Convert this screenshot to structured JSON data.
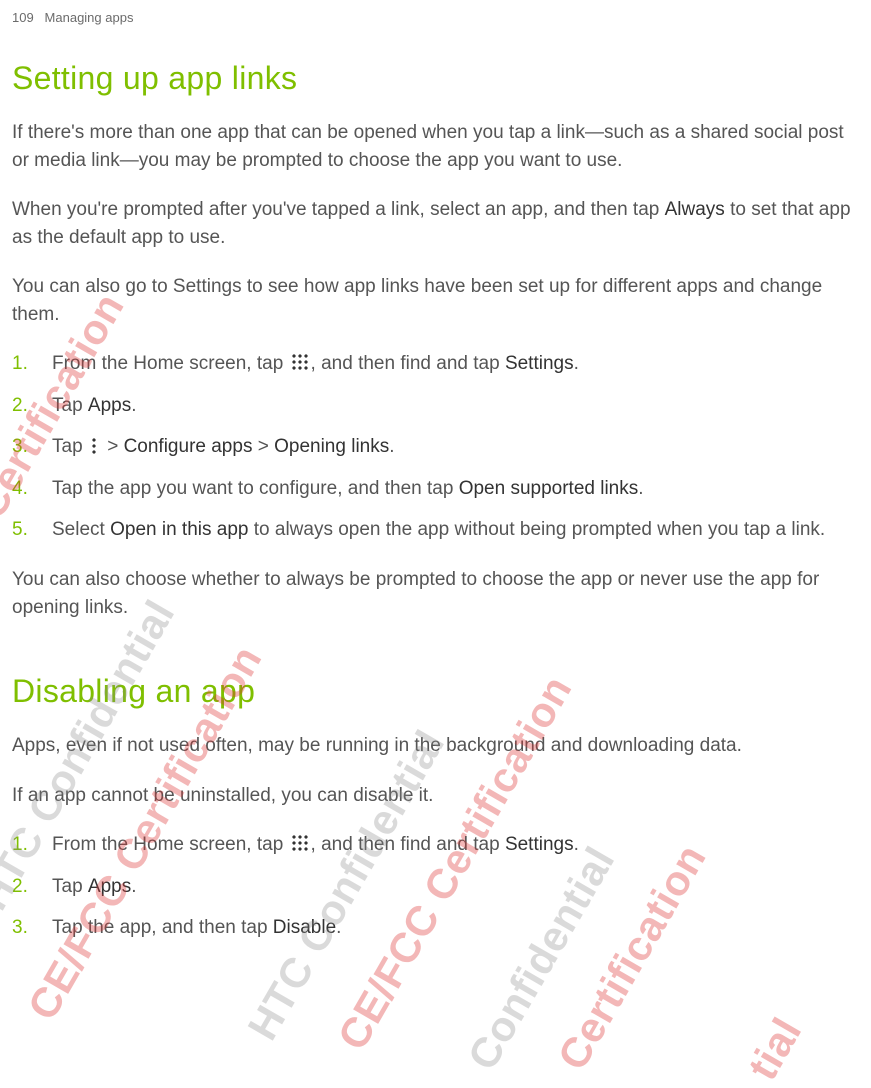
{
  "header": {
    "page_number": "109",
    "chapter": "Managing apps"
  },
  "section1": {
    "title": "Setting up app links",
    "para1": "If there's more than one app that can be opened when you tap a link—such as a shared social post or media link—you may be prompted to choose the app you want to use.",
    "para2_a": "When you're prompted after you've tapped a link, select an app, and then tap ",
    "para2_bold": "Always",
    "para2_b": " to set that app as the default app to use.",
    "para3": "You can also go to Settings to see how app links have been set up for different apps and change them.",
    "steps": [
      {
        "n": "1.",
        "before": "From the Home screen, tap ",
        "after": ", and then find and tap ",
        "bold": "Settings",
        "tail": ".",
        "icon": "apps"
      },
      {
        "n": "2.",
        "before": "Tap ",
        "bold": "Apps",
        "tail": "."
      },
      {
        "n": "3.",
        "before": "Tap ",
        "after": " > ",
        "bold": "Configure apps",
        "mid": " > ",
        "bold2": "Opening links",
        "tail": ".",
        "icon": "more"
      },
      {
        "n": "4.",
        "before": "Tap the app you want to configure, and then tap ",
        "bold": "Open supported links",
        "tail": "."
      },
      {
        "n": "5.",
        "before": "Select ",
        "bold": "Open in this app",
        "after": " to always open the app without being prompted when you tap a link."
      }
    ],
    "para4": "You can also choose whether to always be prompted to choose the app or never use the app for opening links."
  },
  "section2": {
    "title": "Disabling an app",
    "para1": "Apps, even if not used often, may be running in the background and downloading data.",
    "para2": "If an app cannot be uninstalled, you can disable it.",
    "steps": [
      {
        "n": "1.",
        "before": "From the Home screen, tap ",
        "after": ", and then find and tap ",
        "bold": "Settings",
        "tail": ".",
        "icon": "apps"
      },
      {
        "n": "2.",
        "before": "Tap ",
        "bold": "Apps",
        "tail": "."
      },
      {
        "n": "3.",
        "before": "Tap the app, and then tap ",
        "bold": "Disable",
        "tail": "."
      }
    ]
  },
  "watermarks": {
    "w1": "ntial",
    "w2": "e Certification",
    "w3": "HTC Confidential",
    "w4": "CE/FCC Certification",
    "w5": "HTC Confidential",
    "w6": "CE/FCC Certification",
    "w7": "Confidential",
    "w8": "Certification",
    "w9": "tial"
  }
}
